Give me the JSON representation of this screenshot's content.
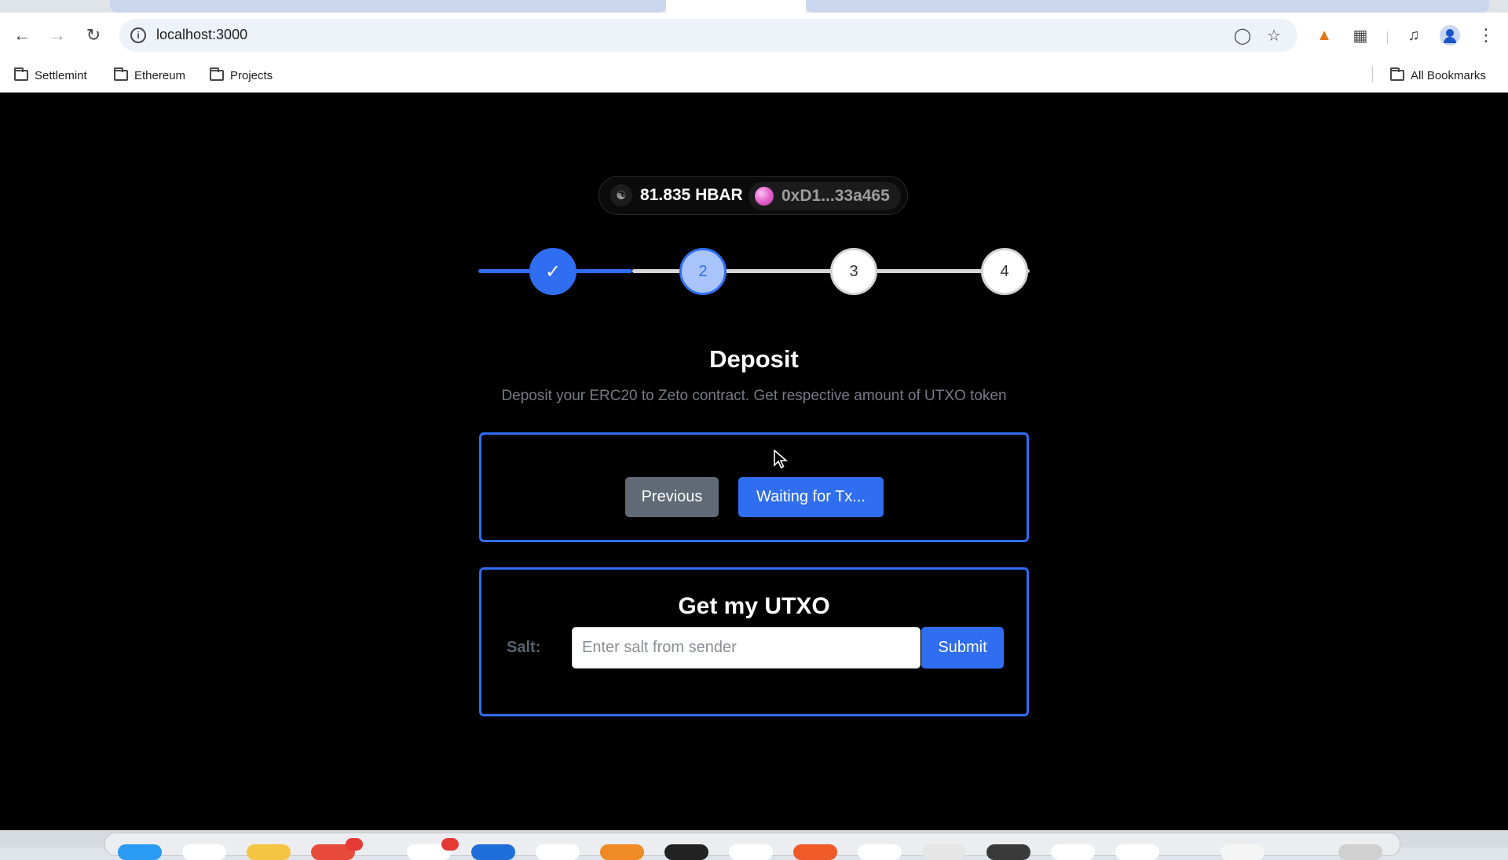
{
  "browser": {
    "url": "localhost:3000",
    "bookmarks": [
      "Settlemint",
      "Ethereum",
      "Projects"
    ],
    "all_bookmarks_label": "All Bookmarks"
  },
  "wallet": {
    "balance": "81.835 HBAR",
    "address": "0xD1...33a465"
  },
  "stepper": {
    "steps": [
      {
        "label": "✓",
        "state": "completed"
      },
      {
        "label": "2",
        "state": "active"
      },
      {
        "label": "3",
        "state": "pending"
      },
      {
        "label": "4",
        "state": "pending"
      }
    ],
    "progress_fraction": 0.25
  },
  "step": {
    "title": "Deposit",
    "description": "Deposit your ERC20 to Zeto contract. Get respective amount of UTXO token"
  },
  "deposit_card": {
    "previous_label": "Previous",
    "primary_label": "Waiting for Tx..."
  },
  "utxo_card": {
    "title": "Get my UTXO",
    "salt_label": "Salt:",
    "salt_value": "",
    "salt_placeholder": "Enter salt from sender",
    "submit_label": "Submit"
  },
  "colors": {
    "accent": "#2f6df1",
    "page_background": "#000000",
    "muted_text": "#757b86",
    "secondary_button": "#5f6a76"
  }
}
